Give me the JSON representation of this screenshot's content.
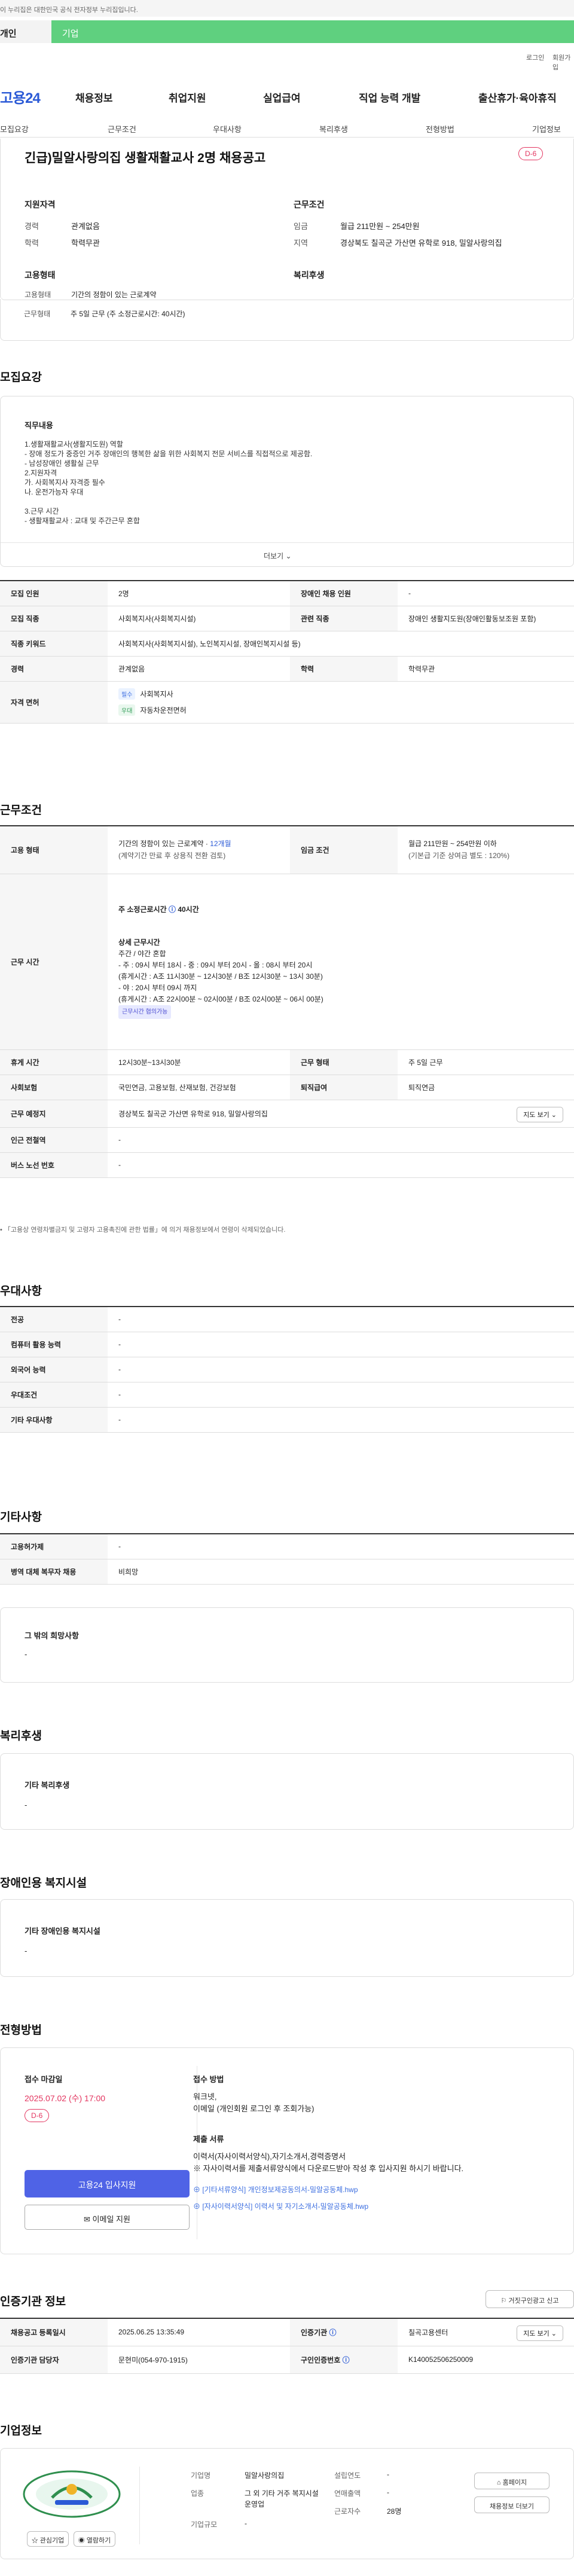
{
  "gov_banner": "이 누리집은 대한민국 공식 전자정부 누리집입니다.",
  "type_tabs": [
    "개인",
    "기업"
  ],
  "util": [
    "로그인",
    "회원가입"
  ],
  "logo": "고용24",
  "gnb": [
    "채용정보",
    "취업지원",
    "실업급여",
    "직업 능력 개발",
    "출산휴가·육아휴직"
  ],
  "subnav": [
    "모집요강",
    "근무조건",
    "우대사항",
    "복리후생",
    "전형방법",
    "기업정보"
  ],
  "summary": {
    "title": "긴급)밀알사랑의집 생활재활교사 2명 채용공고",
    "dday": "D-6",
    "qual_title": "지원자격",
    "qual": [
      [
        "경력",
        "관계없음"
      ],
      [
        "학력",
        "학력무관"
      ]
    ],
    "cond_title": "근무조건",
    "cond": [
      [
        "임금",
        "월급 211만원 ~ 254만원"
      ],
      [
        "지역",
        "경상북도 칠곡군 가산면 유학로 918, 밀알사랑의집"
      ]
    ],
    "form_title": "고용형태",
    "form": [
      [
        "고용형태",
        "기간의 정함이 있는 근로계약"
      ],
      [
        "근무형태",
        "주 5일 근무 (주 소정근로시간: 40시간)"
      ]
    ],
    "welfare_title": "복리후생"
  },
  "recruit": {
    "title": "모집요강",
    "duty_title": "직무내용",
    "duty_lines": [
      "1.생활재활교사(생활지도원) 역할",
      "- 장애 정도가 중증인 거주 장애인의 행복한 삶을 위한 사회복지 전문 서비스를 직접적으로 제공함.",
      "- 남성장애인 생활실 근무",
      "2.지원자격",
      "가. 사회복지사 자격증 필수",
      "나. 운전가능자 우대",
      "",
      "3.근무 시간",
      "- 생활재활교사 : 교대 및 주간근무 혼합"
    ],
    "more": "더보기",
    "rows": [
      {
        "l1": "모집 인원",
        "v1": "2명",
        "l2": "장애인 채용 인원",
        "v2": "-"
      },
      {
        "l1": "모집 직종",
        "v1": "사회복지사(사회복지시설)",
        "l2": "관련 직종",
        "v2": "장애인 생활지도원(장애인활동보조원 포함)"
      },
      {
        "l1": "직종 키워드",
        "v1": "사회복지사(사회복지시설), 노인복지시설, 장애인복지시설 등)"
      },
      {
        "l1": "경력",
        "v1": "관계없음",
        "l2": "학력",
        "v2": "학력무관"
      }
    ],
    "license_label": "자격 면허",
    "licenses": [
      {
        "tag": "필수",
        "name": "사회복지사"
      },
      {
        "tag": "우대",
        "name": "자동차운전면허"
      }
    ]
  },
  "work": {
    "title": "근무조건",
    "emp_label": "고용 형태",
    "emp_value": "기간의 정함이 있는 근로계약 · ",
    "emp_months": "12개월",
    "emp_note": "(계약기간 만료 후 상용직 전환 검토)",
    "pay_label": "임금 조건",
    "pay_value": "월급 211만원 ~ 254만원 이하",
    "pay_note": "(기본급 기준 상여금 별도 : 120%)",
    "time_label": "근무 시간",
    "time_main": "주 소정근로시간",
    "time_hours": "40시간",
    "time_detail_title": "상세 근무시간",
    "time_lines": [
      "주간 / 야간 혼합",
      "- 주 : 09시 부터 18시  - 중 : 09시 부터 20시  - 올 : 08시 부터 20시",
      "(휴게시간 : A조 11시30분 ~ 12시30분 / B조 12시30분 ~ 13시 30분)",
      "- 야 : 20시 부터 09시 까지",
      "(휴게시간 : A조 22시00분 ~ 02시00분 / B조 02시00분 ~ 06시 00분)"
    ],
    "time_chip": "근무시간 협의가능",
    "rows": [
      {
        "l1": "휴게 시간",
        "v1": "12시30분~13시30분",
        "l2": "근무 형태",
        "v2": "주 5일 근무"
      },
      {
        "l1": "사회보험",
        "v1": "국민연금, 고용보험, 산재보험, 건강보험",
        "l2": "퇴직급여",
        "v2": "퇴직연금"
      },
      {
        "l1": "근무 예정지",
        "v1": "경상북도 칠곡군 가산면 유학로 918, 밀알사랑의집",
        "btn": "지도 보기"
      },
      {
        "l1": "인근 전철역",
        "v1": "-"
      },
      {
        "l1": "버스 노선 번호",
        "v1": "-"
      }
    ],
    "footnote": "「고용상 연령차별금지 및 고령자 고용촉진에 관한 법률」에 의거 채용정보에서 연령이 삭제되었습니다."
  },
  "pref": {
    "title": "우대사항",
    "rows": [
      [
        "전공",
        "-"
      ],
      [
        "컴퓨터 활용 능력",
        "-"
      ],
      [
        "외국어 능력",
        "-"
      ],
      [
        "우대조건",
        "-"
      ],
      [
        "기타 우대사항",
        "-"
      ]
    ]
  },
  "etc": {
    "title": "기타사항",
    "rows": [
      [
        "고용허가제",
        "-"
      ],
      [
        "병역 대체 복무자 채용",
        "비희망"
      ]
    ],
    "other_title": "그 밖의 희망사항",
    "other_value": "-"
  },
  "benefit": {
    "title": "복리후생",
    "sub": "기타 복리후생",
    "value": "-"
  },
  "disabled": {
    "title": "장애인용 복지시설",
    "sub": "기타 장애인용 복지시설",
    "value": "-"
  },
  "process": {
    "title": "전형방법",
    "deadline_label": "접수 마감일",
    "deadline": "2025.07.02 (수) 17:00",
    "dday": "D-6",
    "apply_btn": "고용24 입사지원",
    "email_btn": "이메일 지원",
    "method_label": "접수 방법",
    "method": [
      "워크넷,",
      "이메일 (개인회원 로그인 후 조회가능)"
    ],
    "docs_label": "제출 서류",
    "docs": [
      "이력서(자사이력서양식),자기소개서,경력증명서",
      "※ 자사이력서를 제출서류양식에서 다운로드받아 작성 후 입사지원 하시기 바랍니다."
    ],
    "files": [
      "[기타서류양식] 개인정보제공동의서-밀알공동체.hwp",
      "[자사이력서양식] 이력서 및 자기소개서-밀알공동체.hwp"
    ]
  },
  "agency": {
    "title": "인증기관 정보",
    "report_btn": "거짓구인광고 신고",
    "rows": [
      {
        "l1": "채용공고 등록일시",
        "v1": "2025.06.25 13:35:49",
        "l2": "인증기관",
        "v2": "칠곡고용센터",
        "btn": "지도 보기"
      },
      {
        "l1": "인증기관 담당자",
        "v1": "문현미(054-970-1915)",
        "l2": "구인인증번호",
        "v2": "K140052506250009"
      }
    ]
  },
  "company": {
    "title": "기업정보",
    "interest_btn": "관심기업",
    "share_btn": "열람하기",
    "info": [
      [
        "기업명",
        "밀알사랑의집"
      ],
      [
        "업종",
        "그 외 기타 거주 복지시설 운영업"
      ],
      [
        "기업규모",
        "-"
      ]
    ],
    "info2": [
      [
        "설립연도",
        "-"
      ],
      [
        "연매출액",
        "-"
      ],
      [
        "근로자수",
        "28명"
      ]
    ],
    "home_btn": "홈페이지",
    "detail_btn": "채용정보 더보기"
  },
  "colors": {
    "brand": "#2b5ad6",
    "green": "#5fd07f",
    "dday": "#e3345f",
    "deadline": "#e3345f",
    "apply": "#4f63e6"
  }
}
